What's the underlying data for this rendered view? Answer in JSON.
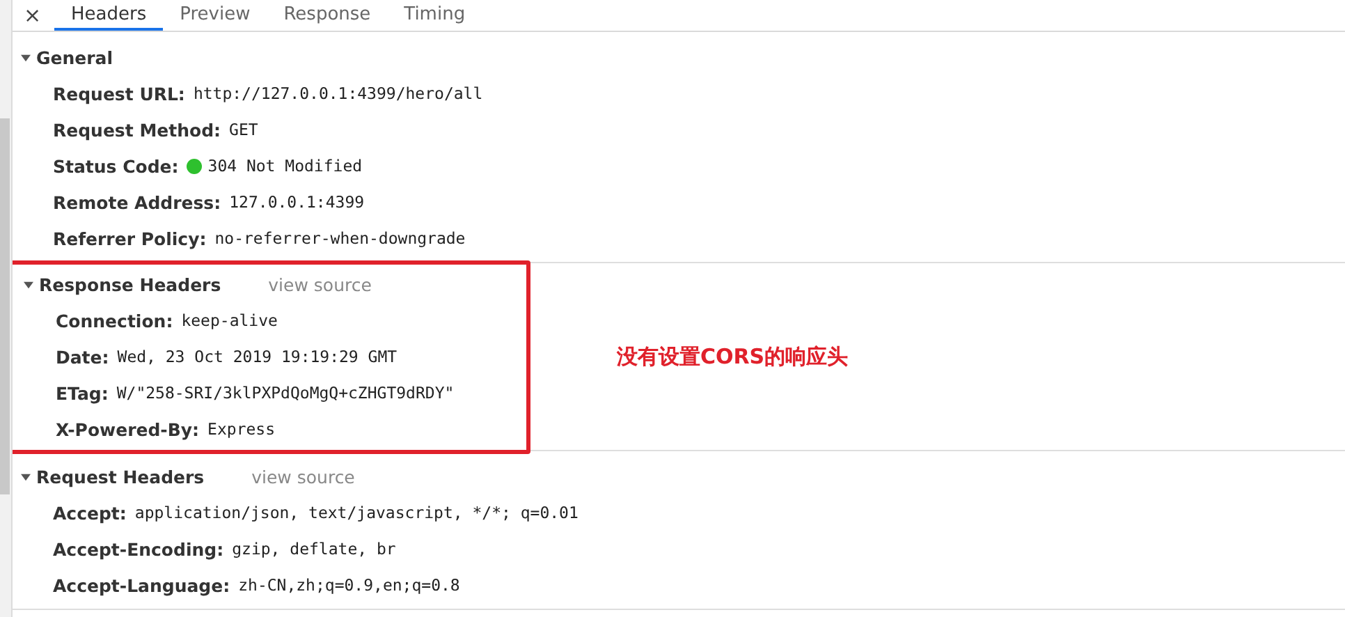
{
  "close_button": "×",
  "tabs": [
    {
      "label": "Headers",
      "selected": true
    },
    {
      "label": "Preview",
      "selected": false
    },
    {
      "label": "Response",
      "selected": false
    },
    {
      "label": "Timing",
      "selected": false
    }
  ],
  "sections": [
    {
      "title": "General",
      "expanded": true,
      "highlighted": false,
      "rows": [
        {
          "name": "Request URL:",
          "value": "http://127.0.0.1:4399/hero/all"
        },
        {
          "name": "Request Method:",
          "value": "GET"
        },
        {
          "name": "Status Code:",
          "value": "304 Not Modified",
          "color": "#2ec02e"
        },
        {
          "name": "Remote Address:",
          "value": "127.0.0.1:4399"
        },
        {
          "name": "Referrer Policy:",
          "value": "no-referrer-when-downgrade"
        }
      ]
    },
    {
      "title": "Response Headers",
      "view_source": "view source",
      "expanded": true,
      "highlighted": true,
      "annotation": "没有设置CORS的响应头",
      "rows": [
        {
          "name": "Connection:",
          "value": "keep-alive"
        },
        {
          "name": "Date:",
          "value": "Wed, 23 Oct 2019 19:19:29 GMT"
        },
        {
          "name": "ETag:",
          "value": "W/\"258-SRI/3klPXPdQoMgQ+cZHGT9dRDY\""
        },
        {
          "name": "X-Powered-By:",
          "value": "Express"
        }
      ]
    },
    {
      "title": "Request Headers",
      "view_source": "view source",
      "expanded": true,
      "highlighted": false,
      "rows": [
        {
          "name": "Accept:",
          "value": "application/json, text/javascript, */*; q=0.01"
        },
        {
          "name": "Accept-Encoding:",
          "value": "gzip, deflate, br"
        },
        {
          "name": "Accept-Language:",
          "value": "zh-CN,zh;q=0.9,en;q=0.8"
        }
      ]
    }
  ]
}
